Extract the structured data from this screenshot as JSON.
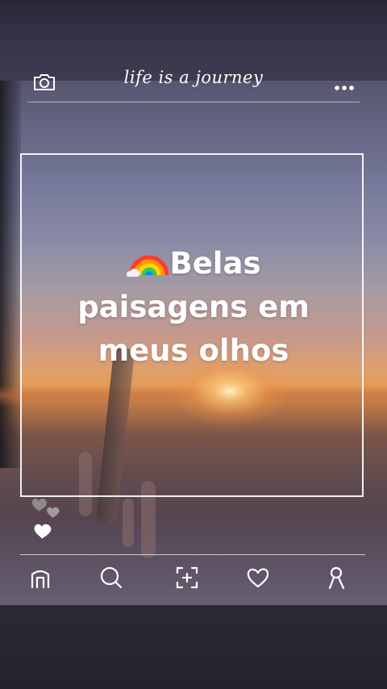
{
  "header": {
    "title": "life is a journey",
    "camera_icon": "camera-icon",
    "more_icon": "more-dots-icon"
  },
  "post": {
    "caption_emoji_icon": "rainbow-icon",
    "caption_lines": [
      "Belas",
      "paisagens em",
      "meus olhos"
    ]
  },
  "reactions": {
    "icons": [
      "heart-icon",
      "heart-icon",
      "heart-icon"
    ]
  },
  "bottom_nav": {
    "items": [
      {
        "icon": "home-icon"
      },
      {
        "icon": "search-icon"
      },
      {
        "icon": "add-post-icon"
      },
      {
        "icon": "heart-icon"
      },
      {
        "icon": "profile-icon"
      }
    ]
  },
  "colors": {
    "foreground": "#ffffff",
    "sunset_orange": "#e39a55",
    "sky_purple": "#5c5b76"
  }
}
